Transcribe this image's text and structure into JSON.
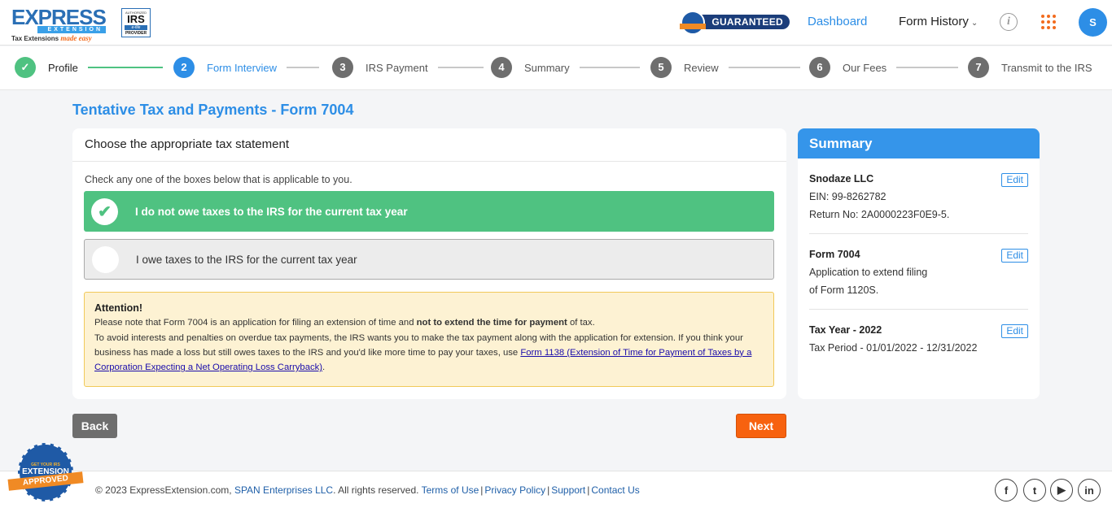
{
  "header": {
    "logo": {
      "word": "EXPRESS",
      "band": "EXTENSION",
      "tagline": "Tax Extensions",
      "tagline_em": "made easy"
    },
    "irs_badge": {
      "line1": "AUTHORIZED",
      "line2": "IRS",
      "line3": "e-file",
      "line4": "PROVIDER"
    },
    "guaranteed": "GUARANTEED",
    "nav": {
      "dashboard": "Dashboard",
      "form_history": "Form History"
    },
    "info_icon": "i",
    "avatar_initial": "S"
  },
  "stepper": {
    "steps": [
      {
        "num": "✓",
        "label": "Profile",
        "state": "done"
      },
      {
        "num": "2",
        "label": "Form Interview",
        "state": "active"
      },
      {
        "num": "3",
        "label": "IRS Payment",
        "state": "pending"
      },
      {
        "num": "4",
        "label": "Summary",
        "state": "pending"
      },
      {
        "num": "5",
        "label": "Review",
        "state": "pending"
      },
      {
        "num": "6",
        "label": "Our Fees",
        "state": "pending"
      },
      {
        "num": "7",
        "label": "Transmit to the IRS",
        "state": "pending"
      }
    ]
  },
  "main": {
    "page_title": "Tentative Tax and Payments - Form 7004",
    "card_title": "Choose the appropriate tax statement",
    "instruction": "Check any one of the boxes below that is applicable to you.",
    "options": [
      {
        "label": "I do not owe taxes to the IRS for the current tax year",
        "selected": true
      },
      {
        "label": "I owe taxes to the IRS for the current tax year",
        "selected": false
      }
    ],
    "attention": {
      "title": "Attention!",
      "line1_pre": "Please note that Form 7004 is an application for filing an extension of time and ",
      "line1_bold": "not to extend the time for payment",
      "line1_post": " of tax.",
      "line2_pre": "To avoid interests and penalties on overdue tax payments, the IRS wants you to make the tax payment along with the application for extension. If you think your business has made a loss but still owes taxes to the IRS and you'd like more time to pay your taxes, use ",
      "link": "Form 1138 (Extension of Time for Payment of Taxes by a Corporation Expecting a Net Operating Loss Carryback)",
      "line2_post": "."
    },
    "back_label": "Back",
    "next_label": "Next"
  },
  "summary": {
    "title": "Summary",
    "edit_label": "Edit",
    "sections": [
      {
        "title": "Snodaze LLC",
        "lines": [
          "EIN: 99-8262782",
          "Return No: 2A0000223F0E9-5."
        ]
      },
      {
        "title": "Form 7004",
        "lines": [
          "Application to extend filing",
          "of Form 1120S."
        ]
      },
      {
        "title": "Tax Year - 2022",
        "lines": [
          "Tax Period - 01/01/2022 - 12/31/2022"
        ]
      }
    ]
  },
  "footer": {
    "badge": {
      "top": "GET YOUR IRS",
      "mid": "EXTENSION",
      "ribbon": "APPROVED"
    },
    "copyright": "© 2023 ExpressExtension.com, ",
    "company": "SPAN Enterprises LLC",
    "rights": ". All rights reserved. ",
    "links": [
      "Terms of Use",
      "Privacy Policy",
      "Support",
      "Contact Us"
    ],
    "social": [
      "f",
      "t",
      "▶",
      "in"
    ]
  },
  "colors": {
    "primary": "#2d8ee6",
    "success": "#4fc281",
    "accent": "#f7620f",
    "attention_bg": "#fdf2d3"
  }
}
